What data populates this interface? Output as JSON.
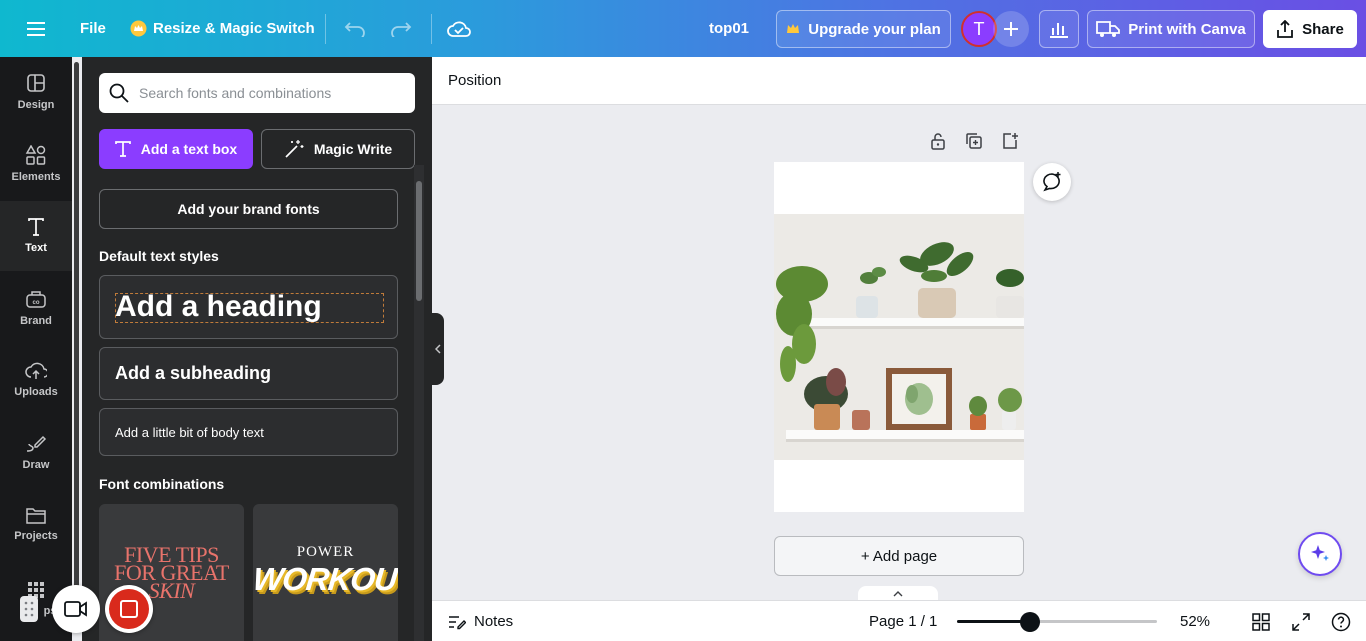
{
  "topbar": {
    "file_label": "File",
    "resize_label": "Resize & Magic Switch",
    "doc_title": "top01",
    "upgrade_label": "Upgrade your plan",
    "avatar_initial": "T",
    "print_label": "Print with Canva",
    "share_label": "Share"
  },
  "rail": {
    "items": [
      {
        "label": "Design",
        "icon": "design-icon"
      },
      {
        "label": "Elements",
        "icon": "elements-icon"
      },
      {
        "label": "Text",
        "icon": "text-icon"
      },
      {
        "label": "Brand",
        "icon": "brand-icon"
      },
      {
        "label": "Uploads",
        "icon": "uploads-icon"
      },
      {
        "label": "Draw",
        "icon": "draw-icon"
      },
      {
        "label": "Projects",
        "icon": "projects-icon"
      },
      {
        "label": "ps",
        "icon": "apps-icon"
      }
    ],
    "active": "Text"
  },
  "panel": {
    "search_placeholder": "Search fonts and combinations",
    "add_text_box": "Add a text box",
    "magic_write": "Magic Write",
    "brand_fonts": "Add your brand fonts",
    "default_styles_title": "Default text styles",
    "heading": "Add a heading",
    "subheading": "Add a subheading",
    "body": "Add a little bit of body text",
    "font_combinations_title": "Font combinations",
    "combos": [
      {
        "lines": [
          "FIVE TIPS",
          "FOR GREAT",
          "SKIN"
        ]
      },
      {
        "lines": [
          "POWER",
          "WORKOUT"
        ]
      }
    ]
  },
  "canvas": {
    "context_label": "Position",
    "add_page": "+ Add page"
  },
  "bottombar": {
    "notes": "Notes",
    "page_indicator": "Page 1 / 1",
    "zoom_percent": "52%",
    "zoom_value": 52
  },
  "colors": {
    "accent_purple": "#8b3dff",
    "rail_bg": "#18191b",
    "panel_bg": "#252627",
    "record_red": "#d92a1c"
  }
}
